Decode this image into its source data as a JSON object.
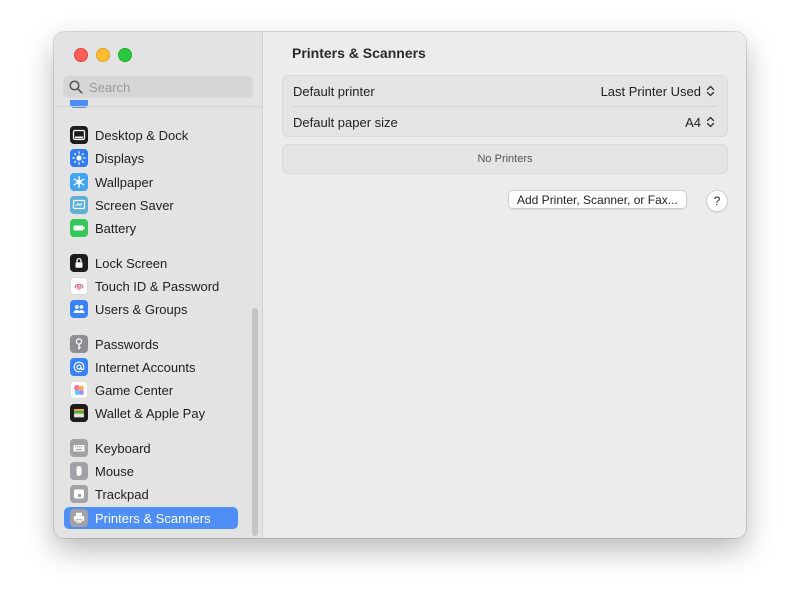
{
  "search": {
    "placeholder": "Search"
  },
  "sidebar": {
    "items": [
      {
        "label": "Desktop & Dock",
        "icon": "dock-icon",
        "color": "#1c1c1e"
      },
      {
        "label": "Displays",
        "icon": "sun-icon",
        "color": "#2f7cf6"
      },
      {
        "label": "Wallpaper",
        "icon": "snowflake-icon",
        "color": "#42a5f5"
      },
      {
        "label": "Screen Saver",
        "icon": "screen-saver-icon",
        "color": "#5fb0d8"
      },
      {
        "label": "Battery",
        "icon": "battery-icon",
        "color": "#34c759"
      },
      {
        "label": "Lock Screen",
        "icon": "lock-icon",
        "color": "#1c1c1e"
      },
      {
        "label": "Touch ID & Password",
        "icon": "fingerprint-icon",
        "color": "#ffffff"
      },
      {
        "label": "Users & Groups",
        "icon": "users-icon",
        "color": "#3b82f6"
      },
      {
        "label": "Passwords",
        "icon": "key-icon",
        "color": "#8e8e93"
      },
      {
        "label": "Internet Accounts",
        "icon": "at-icon",
        "color": "#3b82f6"
      },
      {
        "label": "Game Center",
        "icon": "game-center-icon",
        "color": "#ffffff"
      },
      {
        "label": "Wallet & Apple Pay",
        "icon": "wallet-icon",
        "color": "#1c1c1e"
      },
      {
        "label": "Keyboard",
        "icon": "keyboard-icon",
        "color": "#a1a1a6"
      },
      {
        "label": "Mouse",
        "icon": "mouse-icon",
        "color": "#a1a1a6"
      },
      {
        "label": "Trackpad",
        "icon": "trackpad-icon",
        "color": "#a1a1a6"
      },
      {
        "label": "Printers & Scanners",
        "icon": "printer-icon",
        "color": "#a1a1a6",
        "selected": true
      }
    ]
  },
  "main": {
    "title": "Printers & Scanners",
    "default_printer": {
      "label": "Default printer",
      "value": "Last Printer Used"
    },
    "default_paper": {
      "label": "Default paper size",
      "value": "A4"
    },
    "empty_message": "No Printers",
    "add_button": "Add Printer, Scanner, or Fax...",
    "help_button": "?"
  },
  "colors": {
    "accent": "#4f8ef5",
    "close": "#ff5f57",
    "minimize": "#febc2e",
    "maximize": "#28c840"
  }
}
